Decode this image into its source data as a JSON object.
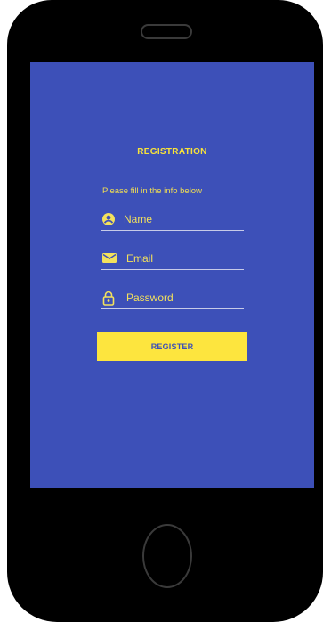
{
  "app": {
    "title": "REGISTRATION",
    "subtitle": "Please fill in the info below"
  },
  "form": {
    "name": {
      "placeholder": "Name",
      "icon": "account-circle-icon"
    },
    "email": {
      "placeholder": "Email",
      "icon": "email-icon"
    },
    "password": {
      "placeholder": "Password",
      "icon": "lock-icon"
    },
    "submit_label": "REGISTER"
  },
  "colors": {
    "screen_background": "#3d50b8",
    "accent": "#fde53e",
    "device_frame": "#000000"
  }
}
